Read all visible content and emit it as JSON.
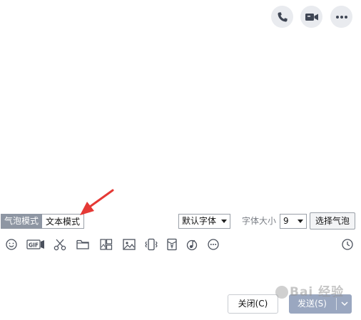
{
  "header": {
    "actions": [
      {
        "icon": "phone-icon"
      },
      {
        "icon": "video-camera-icon"
      },
      {
        "icon": "more-icon"
      }
    ]
  },
  "format_bar": {
    "bubble_mode_label": "气泡模式",
    "text_mode_label": "文本模式",
    "font_value": "默认字体",
    "font_size_label": "字体大小",
    "font_size_value": "9",
    "choose_bubble_label": "选择气泡"
  },
  "toolbar": {
    "gif_label": "GIF",
    "icons": [
      "emoji-icon",
      "gif-icon",
      "scissors-icon",
      "folder-icon",
      "image-gallery-icon",
      "picture-icon",
      "shake-icon",
      "red-packet-icon",
      "music-icon",
      "more-icon",
      "history-icon"
    ]
  },
  "footer": {
    "close_label": "关闭(C)",
    "send_label": "发送(S)"
  },
  "watermark": {
    "text": "Bai 经验"
  },
  "colors": {
    "annotation": "#e53935",
    "bubble_active": "#8e96a3",
    "send_button": "#9aa7c0"
  }
}
